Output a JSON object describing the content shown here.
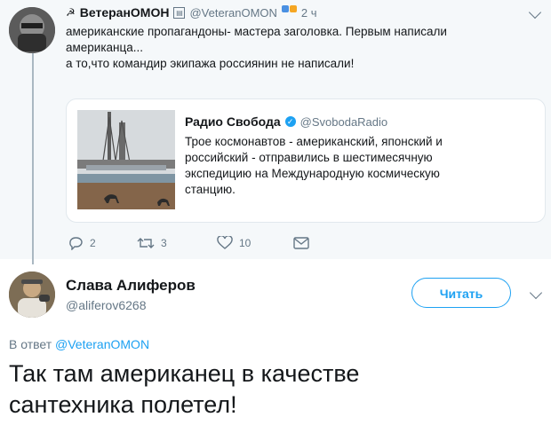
{
  "top_tweet": {
    "author_name": "ВетеранОМОН",
    "handle": "@VeteranOMON",
    "time": "2 ч",
    "text_lines": [
      "американские пропагандоны- мастера заголовка. Первым написали",
      "американца...",
      "а то,что командир экипажа россиянин не написали!"
    ],
    "quote": {
      "author_name": "Радио Свобода",
      "handle": "@SvobodaRadio",
      "text_lines": [
        "Трое космонавтов - американский, японский и",
        "российский - отправились в шестимесячную",
        "экспедицию на Международную космическую",
        "станцию."
      ]
    },
    "actions": {
      "replies": "2",
      "retweets": "3",
      "likes": "10"
    }
  },
  "reply_tweet": {
    "author_name": "Слава Алиферов",
    "handle": "@aliferov6268",
    "follow_label": "Читать",
    "reply_to_prefix": "В ответ",
    "reply_to_handle": "@VeteranOMON",
    "text_lines": [
      "Так там американец в качестве",
      "сантехника полетел!"
    ]
  },
  "colors": {
    "accent": "#1da1f2",
    "secondary_text": "#657786",
    "top_background": "#f5f8fa"
  }
}
